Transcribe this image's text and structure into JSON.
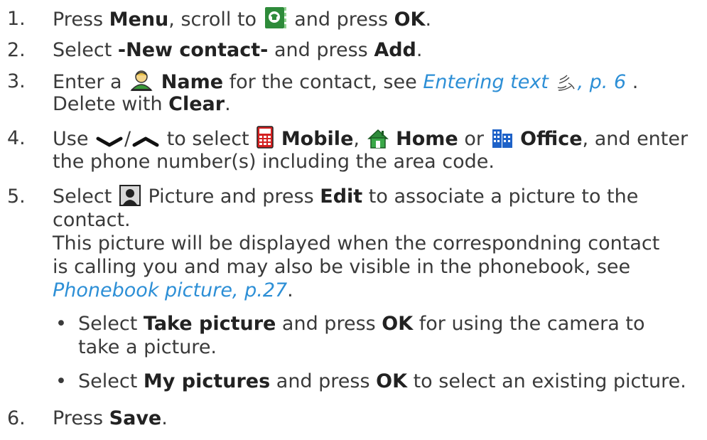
{
  "steps": [
    {
      "num": "1.",
      "a": "Press ",
      "b1": "Menu",
      "c": ", scroll to ",
      "d": " and press ",
      "b2": "OK",
      "e": "."
    },
    {
      "num": "2.",
      "a": "Select ",
      "b1": "-New contact-",
      "c": " and press ",
      "b2": "Add",
      "e": "."
    },
    {
      "num": "3.",
      "a": "Enter a ",
      "b1": "Name",
      "c": " for the contact, see ",
      "link": "Entering text",
      "link2": ", p. 6",
      "e": " .",
      "line2a": "Delete with ",
      "line2b": "Clear",
      "line2c": "."
    },
    {
      "num": "4.",
      "a": "Use ",
      "sep": "/",
      "c": " to select ",
      "mobile": "Mobile",
      "comma": ", ",
      "home": "Home",
      "or": " or ",
      "office": "Office",
      "e": ", and enter",
      "line2": "the phone number(s) including the area code."
    },
    {
      "num": "5.",
      "a": "Select ",
      "c": " Picture and press ",
      "b1": "Edit",
      "e": " to associate a picture to the",
      "line2": "contact.",
      "line3": "This picture will be displayed when the correspondning contact",
      "line4": "is calling you and may also be visible in the phonebook, see",
      "link": "Phonebook picture, p.27",
      "line5end": "."
    },
    {
      "num": "6.",
      "a": "Press ",
      "b1": "Save",
      "e": "."
    }
  ],
  "bullets": [
    {
      "sym": "•",
      "a": "Select ",
      "b1": "Take picture",
      "c": " and press ",
      "b2": "OK",
      "e": " for using the camera to",
      "line2": "take a picture."
    },
    {
      "sym": "•",
      "a": "Select ",
      "b1": "My pictures",
      "c": " and press ",
      "b2": "OK",
      "e": " to select an existing picture."
    }
  ],
  "icons": [
    "phonebook-icon",
    "name-icon",
    "hand-icon",
    "down-arrow-icon",
    "up-arrow-icon",
    "mobile-icon",
    "home-icon",
    "office-icon",
    "picture-icon"
  ],
  "colors": {
    "text": "#3a3a3a",
    "link": "#2d8fd6",
    "icon_green": "#2e8b3a"
  }
}
